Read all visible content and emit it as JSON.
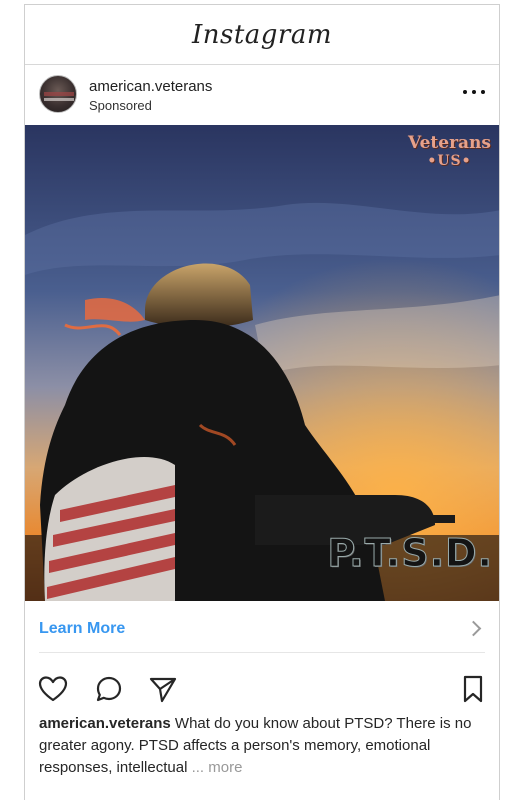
{
  "header": {
    "brand": "Instagram"
  },
  "post": {
    "username": "american.veterans",
    "sponsored_label": "Sponsored",
    "more_icon": "more-horizontal-icon",
    "media": {
      "overlay_title_line1": "Veterans",
      "overlay_title_line2": "•US•",
      "overlay_ptsd": "P.T.S.D."
    },
    "cta": {
      "label": "Learn More",
      "icon": "chevron-right-icon"
    },
    "actions": {
      "like_icon": "heart-icon",
      "comment_icon": "comment-icon",
      "share_icon": "send-icon",
      "save_icon": "bookmark-icon"
    },
    "caption": {
      "username": "american.veterans",
      "text": "What do you know about PTSD? There is no greater agony. PTSD affects a person's memory, emotional responses, intellectual",
      "ellipsis": "...",
      "more_label": "more"
    }
  },
  "colors": {
    "link_blue": "#3897f0",
    "overlay_accent": "#e7a18a"
  }
}
